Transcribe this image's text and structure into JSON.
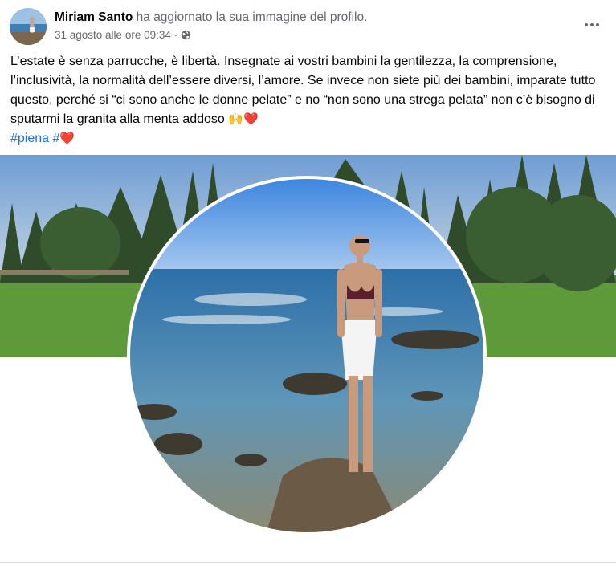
{
  "post": {
    "author_name": "Miriam Santo",
    "action": "ha aggiornato la sua immagine del profilo.",
    "timestamp": "31 agosto alle ore 09:34 ·",
    "privacy_icon": "globe-icon",
    "more_icon": "more-options-icon",
    "body_line1": "L’estate è senza parrucche, è libertà. Insegnate ai vostri bambini la gentilezza, la comprensione, l’inclusività, la normalità dell’essere diversi, l’amore. Se invece non siete più dei bambini, imparate tutto questo, perché si “ci sono anche le donne pelate” e no “non sono una strega pelata” non c’è bisogno di sputarmi la granita alla menta addoso",
    "body_emojis": "🙌❤️",
    "hashtag1": "#piena",
    "hashtag2_prefix": "#",
    "hashtag2_emoji": "❤️"
  },
  "colors": {
    "hashtag": "#1f6fe0",
    "secondary_text": "#65676b",
    "heart": "#e0102f"
  },
  "media": {
    "cover_photo": "cover-photo: park with trees and lawn",
    "profile_photo": "profile-photo: woman in bikini standing on rocks by the sea"
  }
}
